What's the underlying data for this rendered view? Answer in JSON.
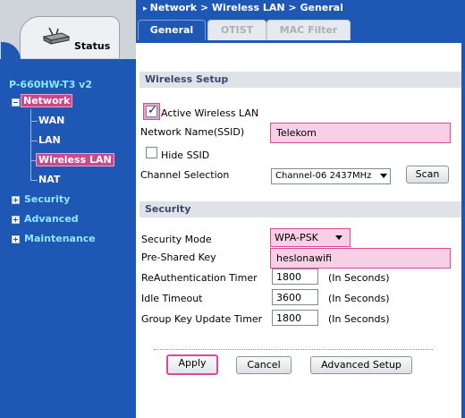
{
  "sidebar": {
    "status_label": "Status",
    "model": "P-660HW-T3 v2",
    "network_label": "Network",
    "network_children": [
      "WAN",
      "LAN",
      "Wireless LAN",
      "NAT"
    ],
    "security_label": "Security",
    "advanced_label": "Advanced",
    "maintenance_label": "Maintenance"
  },
  "breadcrumb": "Network > Wireless LAN > General",
  "tabs": [
    {
      "label": "General",
      "active": true
    },
    {
      "label": "OTIST",
      "active": false
    },
    {
      "label": "MAC Filter",
      "active": false
    }
  ],
  "wireless_setup": {
    "title": "Wireless Setup",
    "active_label": "Active Wireless LAN",
    "active_checked": true,
    "ssid_label": "Network Name(SSID)",
    "ssid_value": "Telekom",
    "hide_ssid_label": "Hide SSID",
    "hide_ssid_checked": false,
    "channel_label": "Channel Selection",
    "channel_value": "Channel-06 2437MHz",
    "scan_label": "Scan"
  },
  "security": {
    "title": "Security",
    "mode_label": "Security Mode",
    "mode_value": "WPA-PSK",
    "psk_label": "Pre-Shared Key",
    "psk_value": "heslonawifi",
    "reauth_label": "ReAuthentication Timer",
    "reauth_value": "1800",
    "reauth_unit": "(In Seconds)",
    "idle_label": "Idle Timeout",
    "idle_value": "3600",
    "idle_unit": "(In Seconds)",
    "group_label": "Group Key Update Timer",
    "group_value": "1800",
    "group_unit": "(In Seconds)"
  },
  "buttons": {
    "apply": "Apply",
    "cancel": "Cancel",
    "advanced": "Advanced Setup"
  },
  "colors": {
    "sidebar_blue": "#1e58b4",
    "highlight_pink": "#d84b9a",
    "field_pink": "#f8d0e6"
  }
}
